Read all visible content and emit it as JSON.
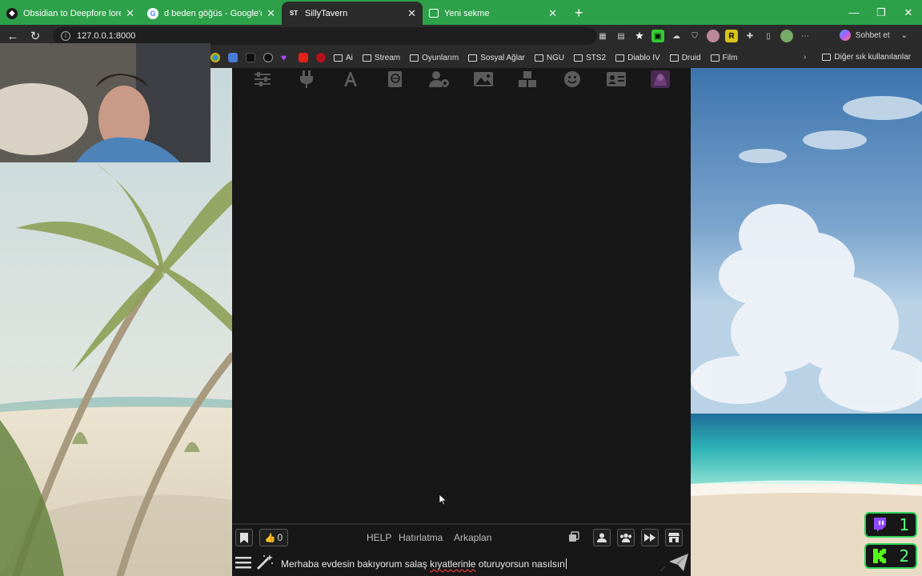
{
  "browser": {
    "tabs": [
      {
        "title": "Obsidian to Deepfore lore conver",
        "favicon": "obsidian",
        "active": false
      },
      {
        "title": "d beden göğüs - Google'da Ara",
        "favicon": "google",
        "active": false
      },
      {
        "title": "SillyTavern",
        "favicon": "ST",
        "active": true
      },
      {
        "title": "Yeni sekme",
        "favicon": "edge-newtab",
        "active": false
      }
    ],
    "url": "127.0.0.1:8000",
    "copilot_label": "Sohbet et",
    "bookmarks": [
      "Ai",
      "Stream",
      "Oyunlarım",
      "Sosyal Ağlar",
      "NGU",
      "STS2",
      "Diablo IV",
      "Druid",
      "Film"
    ],
    "other_bookmarks": "Diğer sık kullanılanlar"
  },
  "app": {
    "top_icons": [
      "sliders-icon",
      "plug-icon",
      "font-icon",
      "book-icon",
      "user-gear-icon",
      "image-icon",
      "cubes-icon",
      "smiley-icon",
      "id-card-icon",
      "character-avatar-icon"
    ],
    "token_count": "0",
    "quick_replies": [
      "HELP",
      "Hatırlatma",
      "Arkaplan"
    ],
    "input": {
      "before": "Merhaba evdesin bakıyorum salaş ",
      "misspelled": "kıyatlerinle",
      "after": " oturuyorsun nasılsın"
    }
  },
  "overlay": {
    "stream_counter_1": "1",
    "stream_counter_2": "2"
  },
  "colors": {
    "tabbar": "#2ea04a",
    "chrome": "#2b2b2b",
    "panel": "#171717",
    "accent_green": "#2fd25a"
  }
}
